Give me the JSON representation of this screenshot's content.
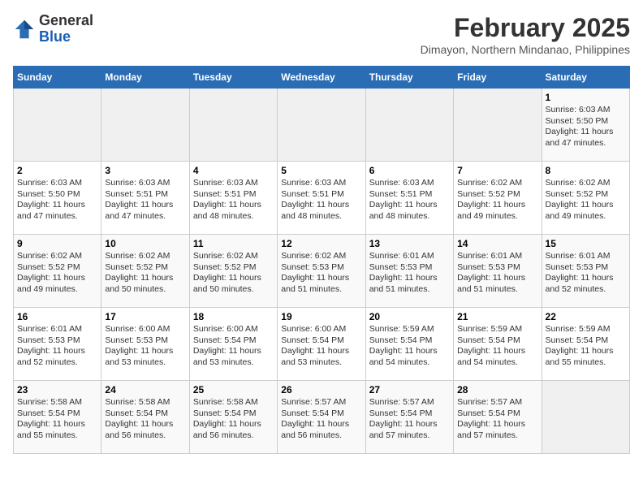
{
  "header": {
    "logo_line1": "General",
    "logo_line2": "Blue",
    "month_year": "February 2025",
    "location": "Dimayon, Northern Mindanao, Philippines"
  },
  "days_of_week": [
    "Sunday",
    "Monday",
    "Tuesday",
    "Wednesday",
    "Thursday",
    "Friday",
    "Saturday"
  ],
  "weeks": [
    [
      {
        "day": "",
        "info": ""
      },
      {
        "day": "",
        "info": ""
      },
      {
        "day": "",
        "info": ""
      },
      {
        "day": "",
        "info": ""
      },
      {
        "day": "",
        "info": ""
      },
      {
        "day": "",
        "info": ""
      },
      {
        "day": "1",
        "info": "Sunrise: 6:03 AM\nSunset: 5:50 PM\nDaylight: 11 hours and 47 minutes."
      }
    ],
    [
      {
        "day": "2",
        "info": "Sunrise: 6:03 AM\nSunset: 5:50 PM\nDaylight: 11 hours and 47 minutes."
      },
      {
        "day": "3",
        "info": "Sunrise: 6:03 AM\nSunset: 5:51 PM\nDaylight: 11 hours and 47 minutes."
      },
      {
        "day": "4",
        "info": "Sunrise: 6:03 AM\nSunset: 5:51 PM\nDaylight: 11 hours and 48 minutes."
      },
      {
        "day": "5",
        "info": "Sunrise: 6:03 AM\nSunset: 5:51 PM\nDaylight: 11 hours and 48 minutes."
      },
      {
        "day": "6",
        "info": "Sunrise: 6:03 AM\nSunset: 5:51 PM\nDaylight: 11 hours and 48 minutes."
      },
      {
        "day": "7",
        "info": "Sunrise: 6:02 AM\nSunset: 5:52 PM\nDaylight: 11 hours and 49 minutes."
      },
      {
        "day": "8",
        "info": "Sunrise: 6:02 AM\nSunset: 5:52 PM\nDaylight: 11 hours and 49 minutes."
      }
    ],
    [
      {
        "day": "9",
        "info": "Sunrise: 6:02 AM\nSunset: 5:52 PM\nDaylight: 11 hours and 49 minutes."
      },
      {
        "day": "10",
        "info": "Sunrise: 6:02 AM\nSunset: 5:52 PM\nDaylight: 11 hours and 50 minutes."
      },
      {
        "day": "11",
        "info": "Sunrise: 6:02 AM\nSunset: 5:52 PM\nDaylight: 11 hours and 50 minutes."
      },
      {
        "day": "12",
        "info": "Sunrise: 6:02 AM\nSunset: 5:53 PM\nDaylight: 11 hours and 51 minutes."
      },
      {
        "day": "13",
        "info": "Sunrise: 6:01 AM\nSunset: 5:53 PM\nDaylight: 11 hours and 51 minutes."
      },
      {
        "day": "14",
        "info": "Sunrise: 6:01 AM\nSunset: 5:53 PM\nDaylight: 11 hours and 51 minutes."
      },
      {
        "day": "15",
        "info": "Sunrise: 6:01 AM\nSunset: 5:53 PM\nDaylight: 11 hours and 52 minutes."
      }
    ],
    [
      {
        "day": "16",
        "info": "Sunrise: 6:01 AM\nSunset: 5:53 PM\nDaylight: 11 hours and 52 minutes."
      },
      {
        "day": "17",
        "info": "Sunrise: 6:00 AM\nSunset: 5:53 PM\nDaylight: 11 hours and 53 minutes."
      },
      {
        "day": "18",
        "info": "Sunrise: 6:00 AM\nSunset: 5:54 PM\nDaylight: 11 hours and 53 minutes."
      },
      {
        "day": "19",
        "info": "Sunrise: 6:00 AM\nSunset: 5:54 PM\nDaylight: 11 hours and 53 minutes."
      },
      {
        "day": "20",
        "info": "Sunrise: 5:59 AM\nSunset: 5:54 PM\nDaylight: 11 hours and 54 minutes."
      },
      {
        "day": "21",
        "info": "Sunrise: 5:59 AM\nSunset: 5:54 PM\nDaylight: 11 hours and 54 minutes."
      },
      {
        "day": "22",
        "info": "Sunrise: 5:59 AM\nSunset: 5:54 PM\nDaylight: 11 hours and 55 minutes."
      }
    ],
    [
      {
        "day": "23",
        "info": "Sunrise: 5:58 AM\nSunset: 5:54 PM\nDaylight: 11 hours and 55 minutes."
      },
      {
        "day": "24",
        "info": "Sunrise: 5:58 AM\nSunset: 5:54 PM\nDaylight: 11 hours and 56 minutes."
      },
      {
        "day": "25",
        "info": "Sunrise: 5:58 AM\nSunset: 5:54 PM\nDaylight: 11 hours and 56 minutes."
      },
      {
        "day": "26",
        "info": "Sunrise: 5:57 AM\nSunset: 5:54 PM\nDaylight: 11 hours and 56 minutes."
      },
      {
        "day": "27",
        "info": "Sunrise: 5:57 AM\nSunset: 5:54 PM\nDaylight: 11 hours and 57 minutes."
      },
      {
        "day": "28",
        "info": "Sunrise: 5:57 AM\nSunset: 5:54 PM\nDaylight: 11 hours and 57 minutes."
      },
      {
        "day": "",
        "info": ""
      }
    ]
  ]
}
